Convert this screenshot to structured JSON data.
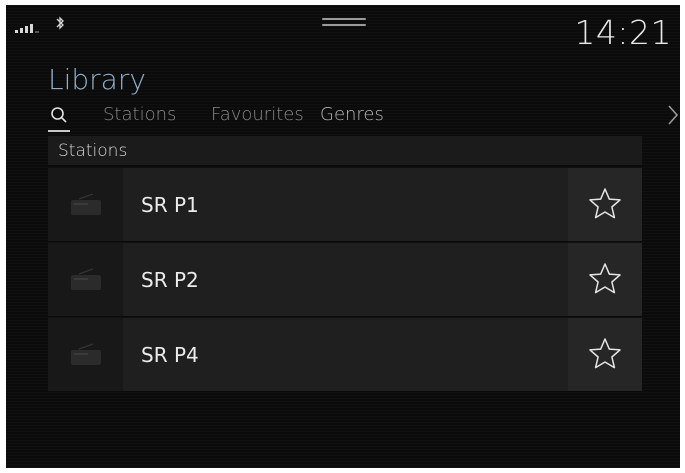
{
  "status_bar": {
    "signal_icon": "signal-strength-icon",
    "bluetooth_icon": "bluetooth-icon",
    "drag_handle_icon": "drag-handle-icon",
    "time": "14:21"
  },
  "header": {
    "title": "Library",
    "tabs": [
      {
        "label": "",
        "icon": "search-icon",
        "active": true
      },
      {
        "label": "Stations"
      },
      {
        "label": "Favourites"
      },
      {
        "label": "Genres"
      }
    ],
    "more_icon": "chevron-right-icon"
  },
  "list": {
    "section_header": "Stations",
    "rows": [
      {
        "name": "SR P1",
        "thumb_icon": "radio-icon",
        "fav_icon": "star-outline-icon",
        "favourite": false
      },
      {
        "name": "SR P2",
        "thumb_icon": "radio-icon",
        "fav_icon": "star-outline-icon",
        "favourite": false
      },
      {
        "name": "SR P4",
        "thumb_icon": "radio-icon",
        "fav_icon": "star-outline-icon",
        "favourite": false
      }
    ]
  },
  "colors": {
    "background": "#0b0b0b",
    "title_accent": "#8fb0cc",
    "row_bg": "#1f1f1f",
    "text_primary": "#ececec",
    "text_muted": "#8a8a8a"
  }
}
